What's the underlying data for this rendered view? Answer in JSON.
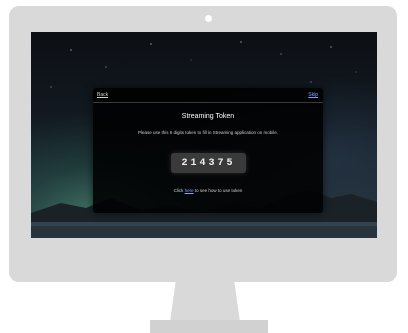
{
  "dialog": {
    "back_label": "Back",
    "skip_label": "Skip",
    "title": "Streaming Token",
    "instruction": "Please use this 6 digits token to fill in Streaming application on mobile.",
    "token": "214375",
    "help_prefix": "Click ",
    "help_link": "here",
    "help_suffix": " to see how to use token"
  },
  "colors": {
    "bezel": "#d9d9d9",
    "dialog_bg": "#000000",
    "token_box": "#3a3a3a",
    "link": "#7fa6ff"
  },
  "icons": [
    "camera-icon"
  ]
}
